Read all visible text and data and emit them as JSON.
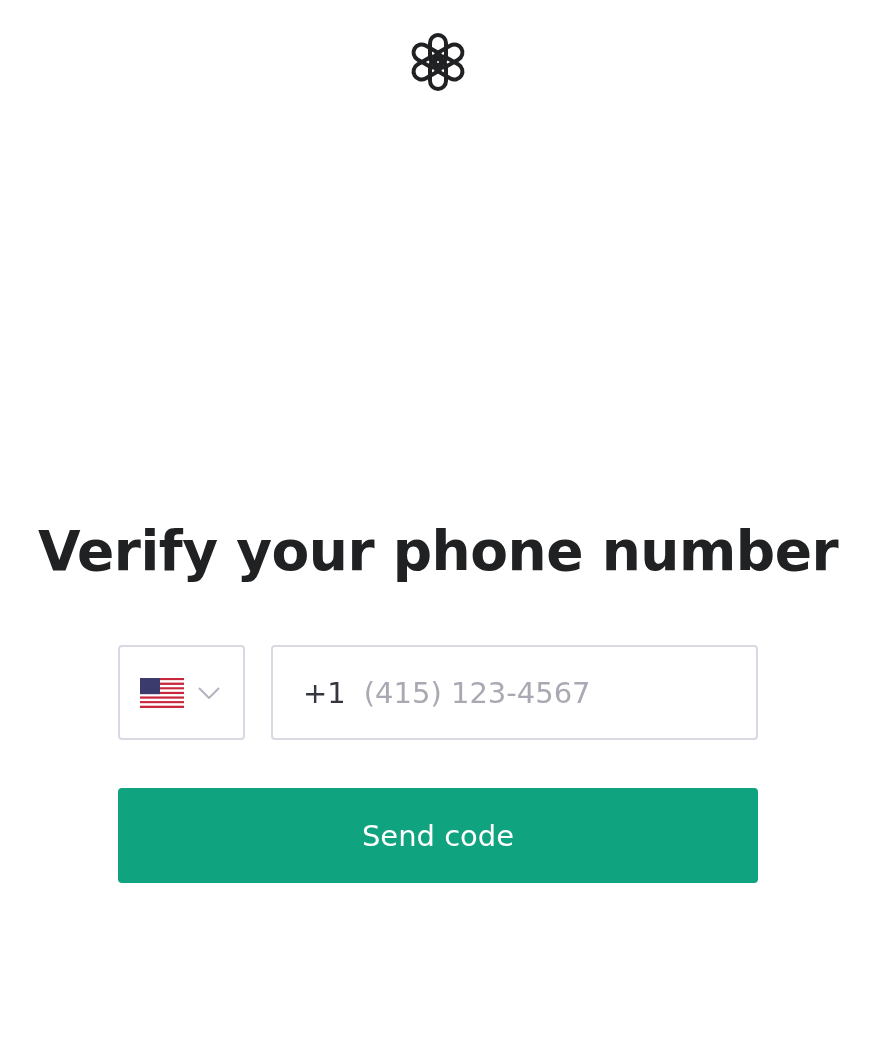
{
  "title": "Verify your phone number",
  "country_select": {
    "expanded": false
  },
  "phone_field": {
    "prefix": "+1",
    "placeholder": "(415) 123-4567"
  },
  "button": {
    "label": "Send code"
  }
}
